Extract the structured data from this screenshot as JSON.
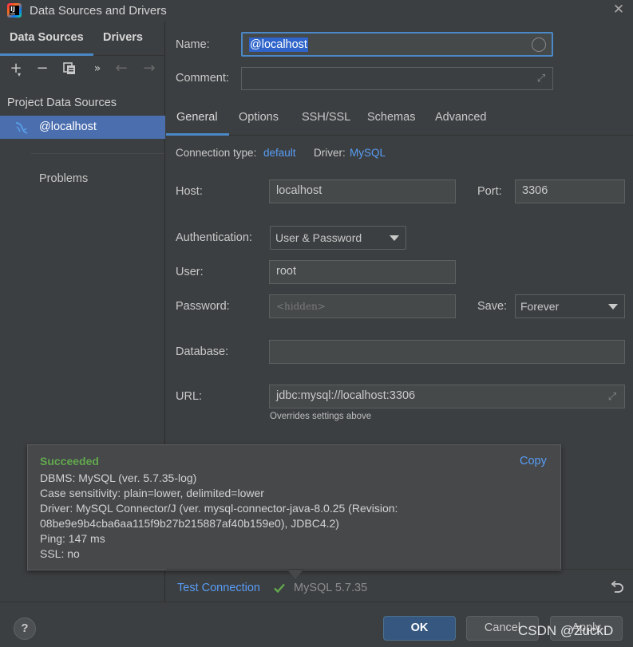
{
  "window": {
    "title": "Data Sources and Drivers",
    "close_icon": "close-icon"
  },
  "left": {
    "tabs": [
      "Data Sources",
      "Drivers"
    ],
    "toolbar": [
      "add-icon",
      "remove-icon",
      "duplicate-icon",
      "more-icon",
      "back-icon",
      "forward-icon"
    ],
    "toolbar_glyphs": {
      "add": "+",
      "remove": "−",
      "more": "»",
      "back": "←",
      "forward": "→"
    },
    "section_title": "Project Data Sources",
    "items": [
      {
        "label": "@localhost"
      }
    ],
    "problems": "Problems"
  },
  "form": {
    "name_label": "Name:",
    "name_value": "@localhost",
    "comment_label": "Comment:",
    "tabs": [
      "General",
      "Options",
      "SSH/SSL",
      "Schemas",
      "Advanced"
    ],
    "connection_type_label": "Connection type:",
    "connection_type_value": "default",
    "driver_label": "Driver:",
    "driver_value": "MySQL",
    "host_label": "Host:",
    "host_value": "localhost",
    "port_label": "Port:",
    "port_value": "3306",
    "auth_label": "Authentication:",
    "auth_value": "User & Password",
    "user_label": "User:",
    "user_value": "root",
    "password_label": "Password:",
    "password_placeholder": "<hidden>",
    "save_label": "Save:",
    "save_value": "Forever",
    "database_label": "Database:",
    "database_value": "",
    "url_label": "URL:",
    "url_value": "jdbc:mysql://localhost:3306",
    "url_hint": "Overrides settings above"
  },
  "popup": {
    "status": "Succeeded",
    "copy": "Copy",
    "lines": [
      "DBMS: MySQL (ver. 5.7.35-log)",
      "Case sensitivity: plain=lower, delimited=lower",
      "Driver: MySQL Connector/J (ver. mysql-connector-java-8.0.25 (Revision:",
      "08be9e9b4cba6aa115f9b27b215887af40b159e0), JDBC4.2)",
      "Ping: 147 ms",
      "SSL: no"
    ]
  },
  "bottom": {
    "test_connection": "Test Connection",
    "test_version": "MySQL 5.7.35"
  },
  "footer": {
    "help": "?",
    "ok": "OK",
    "cancel": "Cancel",
    "apply": "Apply",
    "watermark": "CSDN @ZuckD"
  },
  "colors": {
    "background": "#3c3f41",
    "accent": "#4a88c7",
    "selection": "#4b6eaf",
    "link": "#589df6",
    "success": "#62a84e",
    "primary_button": "#365880"
  }
}
